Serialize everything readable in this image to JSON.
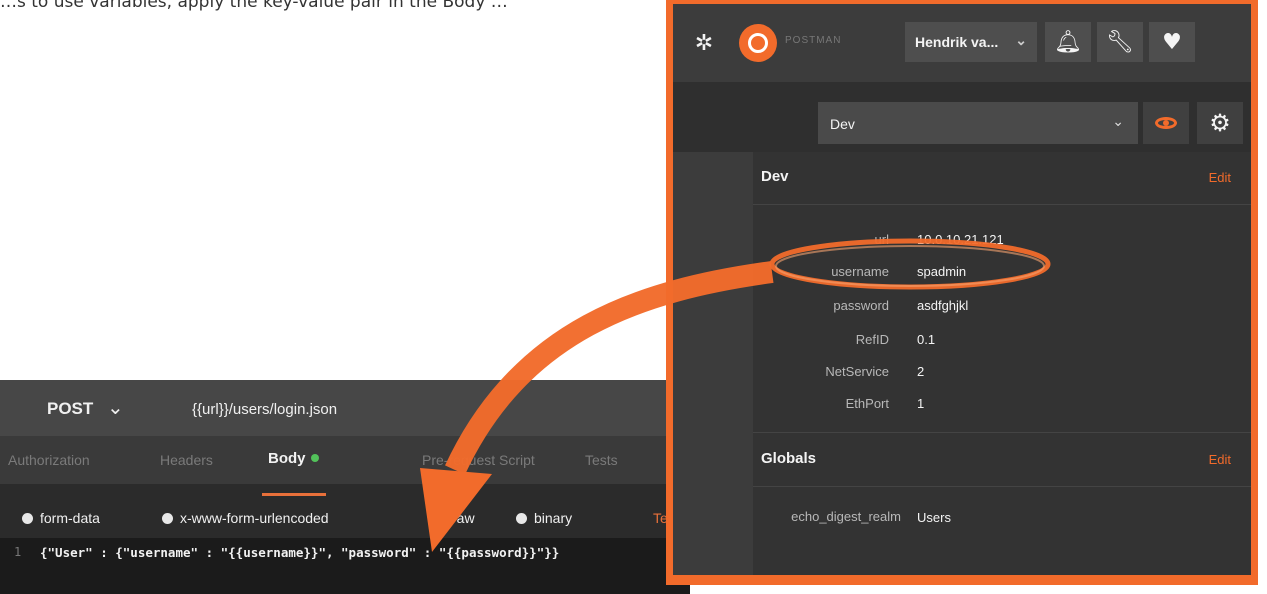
{
  "intro_text": "…s to use variables, apply the key-value pair in the Body …",
  "request": {
    "method": "POST",
    "url": "{{url}}/users/login.json",
    "tabs": [
      {
        "label": "Authorization"
      },
      {
        "label": "Headers"
      },
      {
        "label": "Body"
      },
      {
        "label": "Pre-request Script"
      },
      {
        "label": "Tests"
      }
    ],
    "body_options": [
      {
        "label": "form-data"
      },
      {
        "label": "x-www-form-urlencoded"
      },
      {
        "label": "raw"
      },
      {
        "label": "binary"
      }
    ],
    "content_type": "Text",
    "code_line_number": "1",
    "code": "{\"User\" : {\"username\" : \"{{username}}\", \"password\" : \"{{password}}\"}}"
  },
  "header": {
    "brand": "POSTMAN",
    "user": "Hendrik va...",
    "icons": [
      "sync-icon",
      "bell-icon",
      "wrench-icon",
      "heart-icon"
    ]
  },
  "environment": {
    "selected": "Dev"
  },
  "env_section": {
    "title": "Dev",
    "edit_label": "Edit",
    "rows": [
      {
        "key": "url",
        "value": "10.0.10.21.121"
      },
      {
        "key": "username",
        "value": "spadmin"
      },
      {
        "key": "password",
        "value": "asdfghjkl"
      },
      {
        "key": "RefID",
        "value": "0.1"
      },
      {
        "key": "NetService",
        "value": "2"
      },
      {
        "key": "EthPort",
        "value": "1"
      }
    ]
  },
  "globals_section": {
    "title": "Globals",
    "edit_label": "Edit",
    "rows": [
      {
        "key": "echo_digest_realm",
        "value": "Users"
      }
    ]
  },
  "colors": {
    "accent": "#f26b2b",
    "dark_bg": "#2f2f2f",
    "status_green": "#52c25a"
  }
}
